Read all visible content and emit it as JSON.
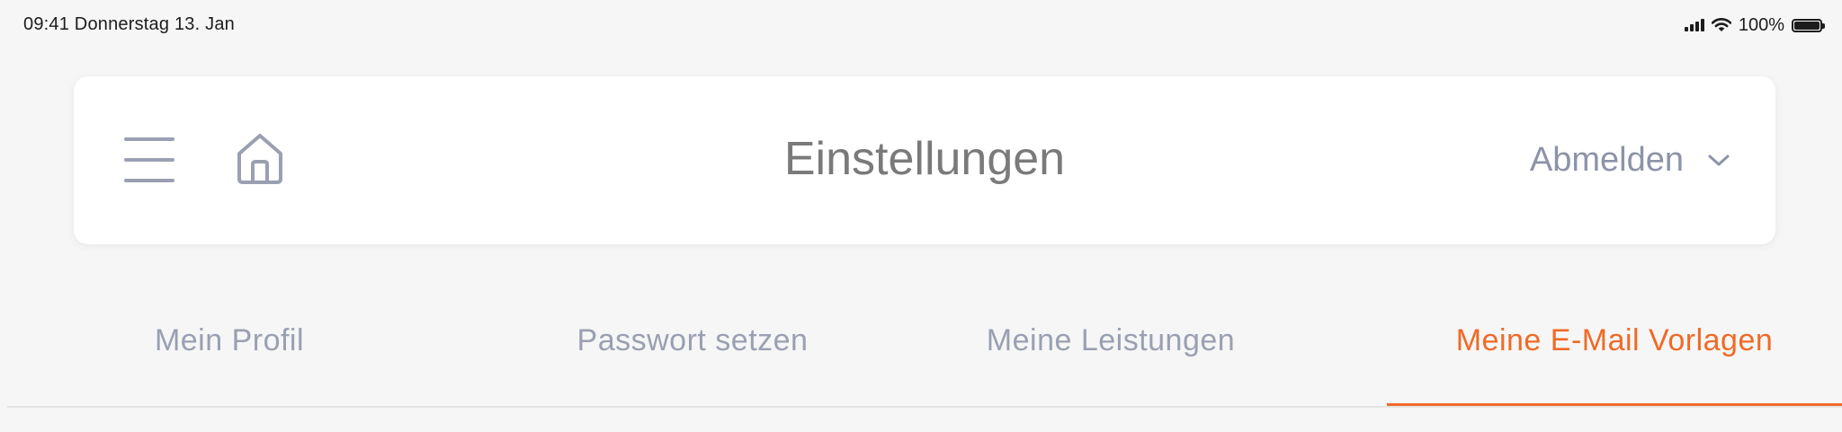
{
  "status_bar": {
    "time_date": "09:41 Donnerstag 13. Jan",
    "battery": "100%",
    "signal_icon": "signal-icon",
    "wifi_icon": "wifi-icon",
    "battery_icon": "battery-icon"
  },
  "header": {
    "title": "Einstellungen",
    "menu_icon": "hamburger-menu-icon",
    "home_icon": "home-icon",
    "logout_label": "Abmelden",
    "logout_chevron": "chevron-down-icon"
  },
  "tabs": [
    {
      "label": "Mein Profil",
      "active": false
    },
    {
      "label": "Passwort setzen",
      "active": false
    },
    {
      "label": "Meine Leistungen",
      "active": false
    },
    {
      "label": "Meine E-Mail Vorlagen",
      "active": true
    }
  ],
  "colors": {
    "accent": "#f06a26",
    "muted_text": "#9aa0b2",
    "title_text": "#7a7a7a",
    "background": "#f6f6f6",
    "card": "#ffffff"
  }
}
